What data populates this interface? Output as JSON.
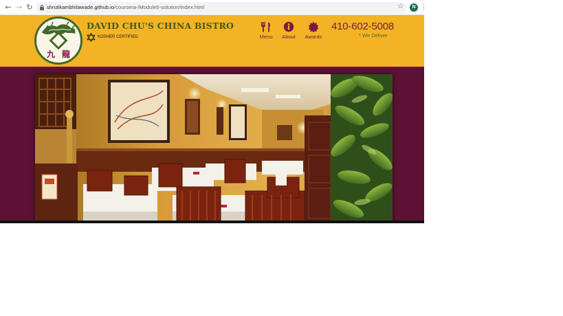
{
  "browser": {
    "url_host": "shrutikambhilawade.github.io",
    "url_path": "/coursera-/Module5-solution/index.html",
    "profile_initial": "N",
    "icons": {
      "back": "arrow-left-icon",
      "forward": "arrow-right-icon",
      "reload": "reload-icon",
      "lock": "lock-icon",
      "bookmark": "star-icon",
      "menu": "kebab-menu-icon"
    }
  },
  "header": {
    "restaurant_name": "DAVID CHU'S CHINA BISTRO",
    "kosher_label": "KOSHER CERTIFIED",
    "nav": [
      {
        "label": "Menu",
        "icon": "cutlery-icon"
      },
      {
        "label": "About",
        "icon": "info-icon"
      },
      {
        "label": "Awards",
        "icon": "certificate-icon"
      }
    ],
    "phone": "410-602-5008",
    "delivery": "* We Deliver"
  },
  "hero": {
    "image": "restaurant-interior-photo"
  },
  "colors": {
    "header_bg": "#f4b324",
    "content_bg": "#5e1233",
    "accent": "#7a1a40",
    "brand_green": "#3f5a23"
  }
}
